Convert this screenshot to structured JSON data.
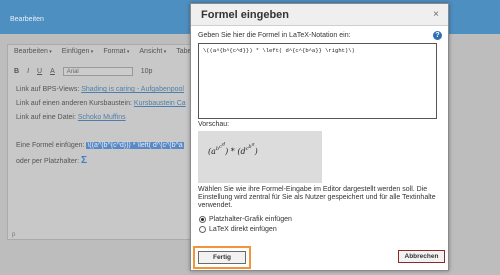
{
  "background": {
    "window_title": "Bearbeiten",
    "menu": [
      "Bearbeiten",
      "Einfügen",
      "Format",
      "Ansicht",
      "Tabe"
    ],
    "toolbar": {
      "bold": "B",
      "italic": "I",
      "underline": "U",
      "color": "A",
      "font": "Arial",
      "size": "10p"
    },
    "lines": [
      {
        "prefix": "Link auf BPS-Views: ",
        "link": "Shading is caring - Aufgabenpool"
      },
      {
        "prefix": "Link auf einen anderen Kursbaustein: ",
        "link": "Kursbaustein Ca"
      },
      {
        "prefix": "Link auf eine Datei: ",
        "link": "Schoko Muffins"
      }
    ],
    "formula_line_prefix": "Eine Formel einfügen: ",
    "formula_line_selected": "\\((a^{b^{c^d}}) * \\left( d^{c^{b^a",
    "placeholder_line": "oder per Platzhalter: ",
    "sigma": "Σ",
    "footer": "p"
  },
  "dialog": {
    "title": "Formel eingeben",
    "close": "×",
    "prompt": "Geben Sie hier die Formel in LaTeX-Notation ein:",
    "help": "?",
    "latex": "\\((a^{b^{c^d}}) * \\left( d^{c^{b^a}} \\right)\\)",
    "preview_label": "Vorschau:",
    "preview_left": "(a",
    "preview_sup1": "b",
    "preview_sup1b": "c",
    "preview_sup1c": "d",
    "preview_mid": ") * (",
    "preview_d": "d",
    "preview_sup2": "c",
    "preview_sup2b": "b",
    "preview_sup2c": "a",
    "preview_right": ")",
    "note": "Wählen Sie wie ihre Formel-Eingabe im Editor dargestellt werden soll. Die Einstellung wird zentral für Sie als Nutzer gespeichert und für alle Textinhalte verwendet.",
    "radio_graphic": "Platzhalter-Grafik einfügen",
    "radio_latex": "LaTeX direkt einfügen",
    "ok": "Fertig",
    "cancel": "Abbrechen"
  }
}
